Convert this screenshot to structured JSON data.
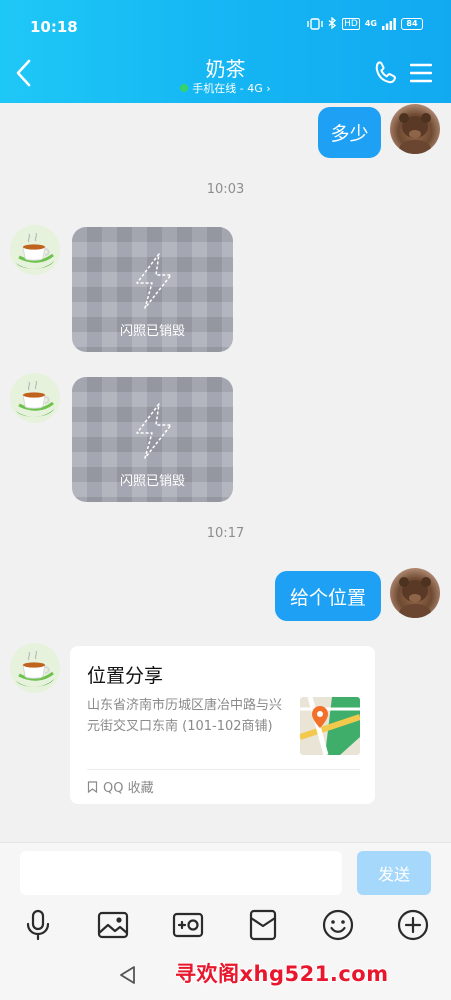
{
  "status_bar": {
    "time": "10:18",
    "hd_label": "HD",
    "net_label": "4G",
    "battery": "84"
  },
  "header": {
    "title": "奶茶",
    "status": "手机在线 - 4G",
    "status_arrow": "›"
  },
  "messages": {
    "msg1": {
      "text": "多少"
    },
    "time1": "10:03",
    "flash1": {
      "label": "闪照已销毁"
    },
    "flash2": {
      "label": "闪照已销毁"
    },
    "time2": "10:17",
    "msg2": {
      "text": "给个位置"
    },
    "location": {
      "title": "位置分享",
      "address": "山东省济南市历城区唐冶中路与兴元街交叉口东南 (101-102商铺)",
      "source": "QQ 收藏"
    }
  },
  "input": {
    "placeholder": "",
    "send_label": "发送"
  },
  "watermark": "寻欢阁xhg521.com",
  "colors": {
    "accent": "#1ea0f4",
    "header": "#15b6f3",
    "send_disabled": "#a6d8fb",
    "online": "#34d46b"
  }
}
